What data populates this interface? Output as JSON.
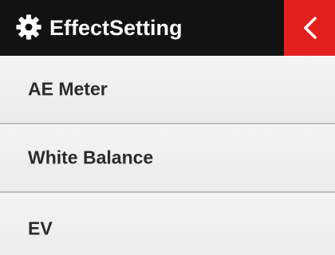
{
  "header": {
    "title": "EffectSetting",
    "settings_icon": "gear-icon",
    "back_icon": "chevron-left-icon",
    "background_color": "#121212",
    "back_button_color": "#e4201f"
  },
  "menu": {
    "items": [
      {
        "label": "AE Meter"
      },
      {
        "label": "White Balance"
      },
      {
        "label": "EV"
      }
    ]
  }
}
